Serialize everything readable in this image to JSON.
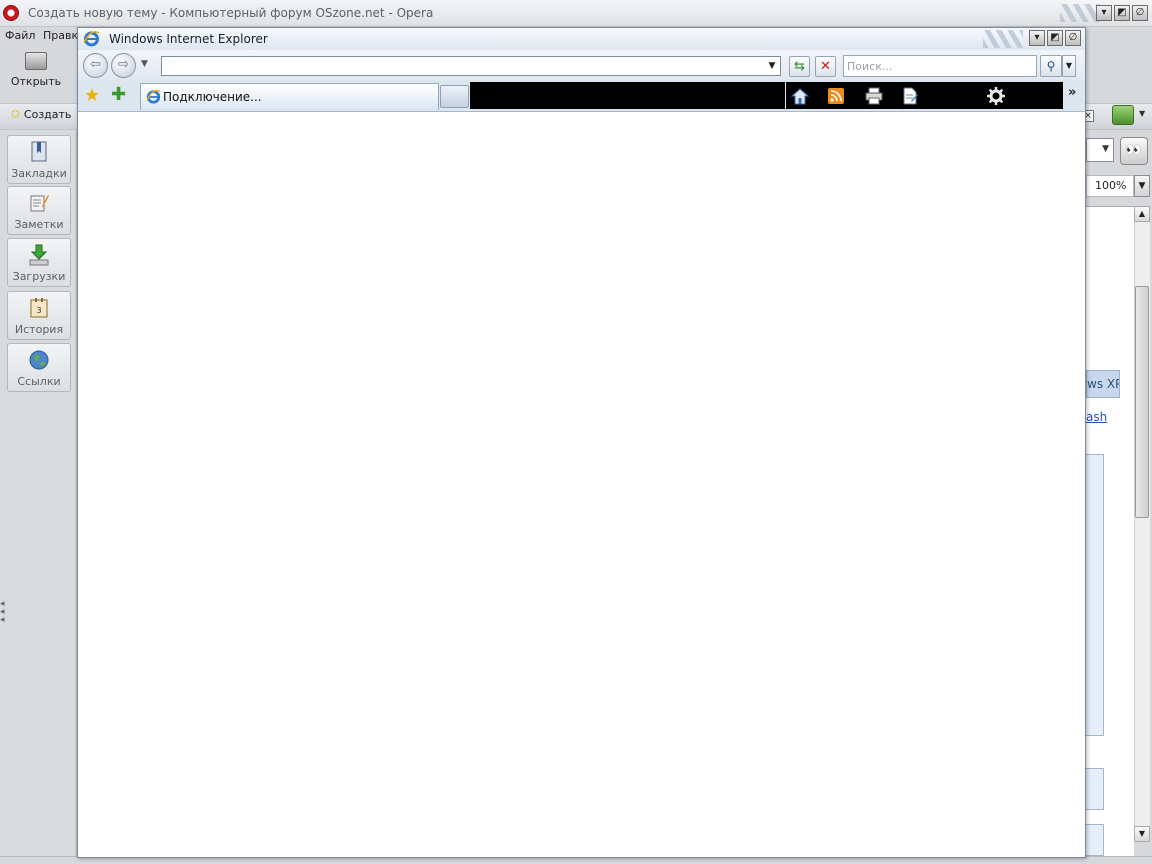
{
  "opera": {
    "title": "Создать новую тему - Компьютерный форум OSzone.net - Opera",
    "menu": [
      "Файл",
      "Правка"
    ],
    "open_label": "Открыть",
    "create_label": "Создать",
    "zoom": "100%",
    "xp_text": "ws XP",
    "flash_link": "ash",
    "side_panel": [
      "Закладки",
      "Заметки",
      "Загрузки",
      "История",
      "Ссылки"
    ]
  },
  "ie": {
    "title": "Windows Internet Explorer",
    "address": "",
    "search_placeholder": "Поиск...",
    "tab_label": "Подключение..."
  },
  "colors": {
    "ie_titlebar": "#dfe6ef",
    "ie_cmdbar": "#dde5ef",
    "side_panel": "#d8dade",
    "opera_red": "#c8171e"
  }
}
